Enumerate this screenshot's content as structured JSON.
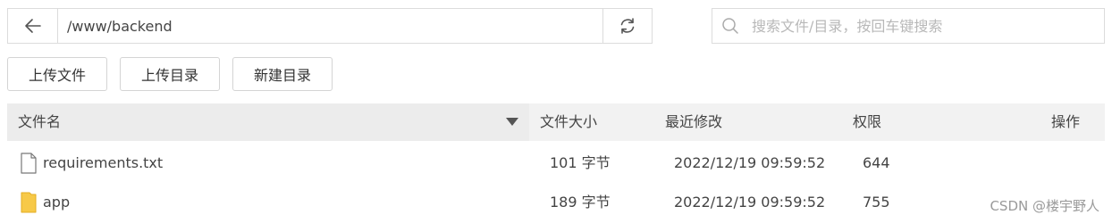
{
  "nav": {
    "path": "/www/backend"
  },
  "search": {
    "placeholder": "搜索文件/目录，按回车键搜索"
  },
  "toolbar": {
    "upload_file": "上传文件",
    "upload_dir": "上传目录",
    "new_dir": "新建目录"
  },
  "table": {
    "headers": {
      "name": "文件名",
      "size": "文件大小",
      "modified": "最近修改",
      "perms": "权限",
      "actions": "操作"
    },
    "rows": [
      {
        "icon": "file-icon",
        "name": "requirements.txt",
        "size": "101 字节",
        "modified": "2022/12/19 09:59:52",
        "perms": "644"
      },
      {
        "icon": "folder-icon",
        "name": "app",
        "size": "189 字节",
        "modified": "2022/12/19 09:59:52",
        "perms": "755"
      }
    ]
  },
  "watermark": "CSDN @楼宇野人",
  "colors": {
    "folder": "#f7c948",
    "header_bg": "#f2f2f2",
    "border": "#dcdcdc"
  }
}
